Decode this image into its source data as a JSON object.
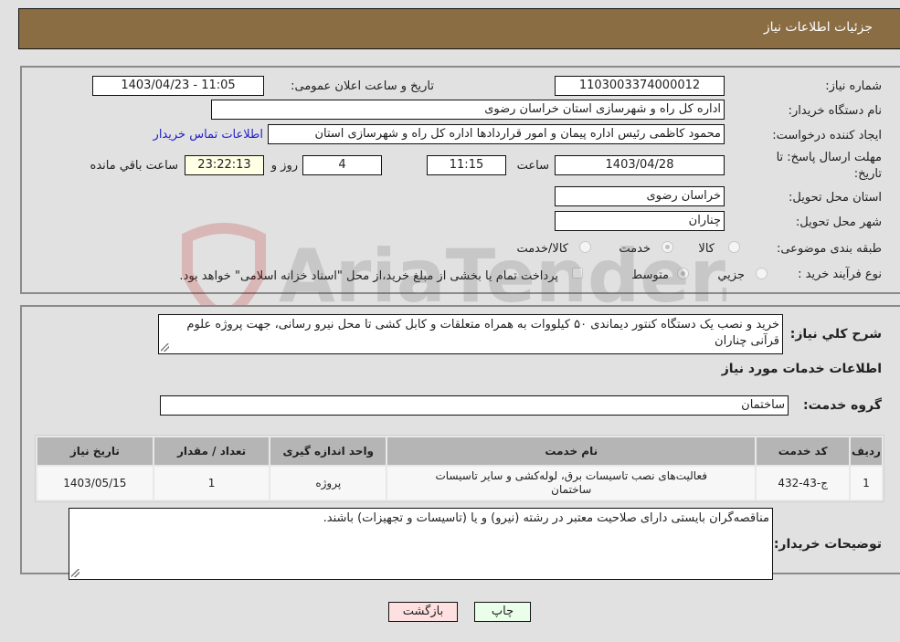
{
  "header": {
    "title": "جزئیات اطلاعات نیاز"
  },
  "details": {
    "need_number_label": "شماره نیاز:",
    "need_number": "1103003374000012",
    "announce_label": "تاریخ و ساعت اعلان عمومی:",
    "announce_value": "1403/04/23 - 11:05",
    "buyer_org_label": "نام دستگاه خریدار:",
    "buyer_org": "اداره کل راه و شهرسازی استان خراسان رضوی",
    "creator_label": "ایجاد کننده درخواست:",
    "creator": "محمود کاظمی رئیس اداره پیمان و امور قراردادها اداره کل راه و شهرسازی استان",
    "contact_link": "اطلاعات تماس خریدار",
    "deadline_label_line1": "مهلت ارسال پاسخ: تا",
    "deadline_label_line2": "تاریخ:",
    "deadline_date": "1403/04/28",
    "time_label": "ساعت",
    "deadline_time": "11:15",
    "days_value": "4",
    "days_label": "روز و",
    "remaining_time": "23:22:13",
    "remaining_label": "ساعت باقي مانده",
    "province_label": "استان محل تحویل:",
    "province": "خراسان رضوی",
    "city_label": "شهر محل تحویل:",
    "city": "چناران",
    "category_label": "طبقه بندی موضوعی:",
    "category_options": [
      {
        "label": "کالا",
        "selected": false
      },
      {
        "label": "خدمت",
        "selected": true
      },
      {
        "label": "کالا/خدمت",
        "selected": false
      }
    ],
    "process_label": "نوع فرآیند خرید :",
    "process_options": [
      {
        "label": "جزيي",
        "selected": false
      },
      {
        "label": "متوسط",
        "selected": true
      }
    ],
    "treasury_checkbox_label": "پرداخت تمام یا بخشی از مبلغ خرید،از محل \"اسناد خزانه اسلامی\" خواهد بود.",
    "treasury_checked": false
  },
  "summary": {
    "description_label": "شرح كلي نياز:",
    "description": "خرید و نصب یک دستگاه کنتور دیماندی ۵۰ کیلووات به همراه متعلقات و کابل کشی تا محل نیرو رسانی، جهت پروژه علوم قرآنی چناران",
    "services_heading": "اطلاعات خدمات مورد نیاز",
    "service_group_label": "گروه خدمت:",
    "service_group": "ساختمان",
    "table": {
      "columns": [
        "ردیف",
        "کد خدمت",
        "نام خدمت",
        "واحد اندازه گیری",
        "تعداد / مقدار",
        "تاریخ نیاز"
      ],
      "rows": [
        [
          "1",
          "ج-43-432",
          "فعالیت‌های نصب تاسیسات برق، لوله‌کشی و سایر تاسیسات ساختمان",
          "پروژه",
          "1",
          "1403/05/15"
        ]
      ]
    },
    "buyer_notes_label": "توضیحات خریدار:",
    "buyer_notes": "مناقصه‌گران بایستی دارای صلاحیت معتبر در رشته (نیرو) و یا (تاسیسات و تجهیزات) باشند."
  },
  "buttons": {
    "print": "چاپ",
    "back": "بازگشت"
  },
  "watermark": {
    "text": "AriaTender.neT"
  },
  "colors": {
    "header_bg": "#8b6d43",
    "back_button_bg": "#ffe0e0",
    "print_button_bg": "#eaffea",
    "remaining_bg": "#ffffe6",
    "link": "#2222cc"
  }
}
